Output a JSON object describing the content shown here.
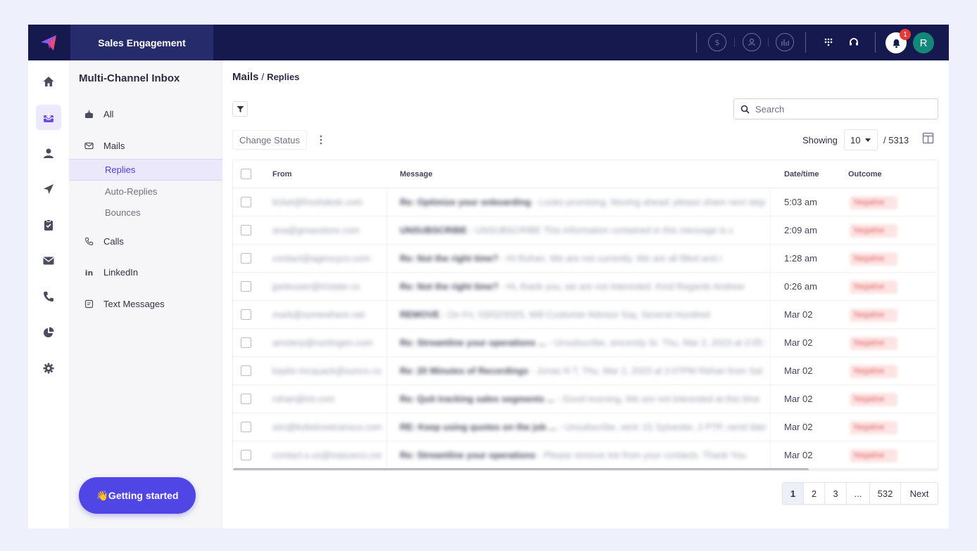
{
  "topbar": {
    "product": "Sales Engagement",
    "notification_count": "1",
    "avatar_initial": "R"
  },
  "sidebar": {
    "title": "Multi-Channel Inbox",
    "items": [
      {
        "label": "All",
        "icon": "inbox-all-icon"
      },
      {
        "label": "Mails",
        "icon": "mail-icon"
      },
      {
        "label": "Calls",
        "icon": "phone-icon"
      },
      {
        "label": "LinkedIn",
        "icon": "linkedin-icon"
      },
      {
        "label": "Text Messages",
        "icon": "text-message-icon"
      }
    ],
    "mail_subitems": [
      "Replies",
      "Auto-Replies",
      "Bounces"
    ],
    "active_subitem": "Replies",
    "getting_started": "👋Getting started"
  },
  "main": {
    "breadcrumb_parent": "Mails",
    "breadcrumb_sep": " / ",
    "breadcrumb_current": "Replies",
    "search_placeholder": "Search",
    "change_status": "Change Status",
    "showing_label": "Showing",
    "page_size": "10",
    "total": "/ 5313",
    "columns": {
      "from": "From",
      "message": "Message",
      "datetime": "Date/time",
      "outcome": "Outcome"
    },
    "rows": [
      {
        "from": "ticket@freshdesk.com",
        "subject": "Re: Optimize your onboarding",
        "preview": "- Looks promising. Moving ahead; please share next steps",
        "datetime": "5:03 am",
        "outcome": "Negative"
      },
      {
        "from": "ana@gmaxstore.com",
        "subject": "UNSUBSCRIBE",
        "preview": "- UNSUBSCRIBE This information contained in this message is c",
        "datetime": "2:09 am",
        "outcome": "Negative"
      },
      {
        "from": "contact@agencyco.com",
        "subject": "Re: Not the right time?",
        "preview": "- Hi Rohan, We are not currently. We are all filled and r",
        "datetime": "1:28 am",
        "outcome": "Negative"
      },
      {
        "from": "jpelessier@tristate.co",
        "subject": "Re: Not the right time?",
        "preview": "- Hi, thank you, we are not interested. Kind Regards Andrew",
        "datetime": "0:26 am",
        "outcome": "Negative"
      },
      {
        "from": "mark@somewhere.net",
        "subject": "REMOVE",
        "preview": "- On Fri, 03/02/2025, Will Customer Advisor Say, Several Hundred",
        "datetime": "Mar 02",
        "outcome": "Negative"
      },
      {
        "from": "amsterp@nortingen.com",
        "subject": "Re: Streamline your operations ...",
        "preview": "- Unsubscribe, sincerely Sr. Thu, Mar 2, 2023 at 2:05 P",
        "datetime": "Mar 02",
        "outcome": "Negative"
      },
      {
        "from": "kaylor.mcquack@sunco.com",
        "subject": "Re: 20 Minutes of Recordings",
        "preview": "- Jonas N T, Thu, Mar 2, 2023 at 2:07PM Rehan from Sal",
        "datetime": "Mar 02",
        "outcome": "Negative"
      },
      {
        "from": "rohan@int.com",
        "subject": "Re: Quit tracking sales segments ...",
        "preview": "- Good morning, We are not interested at this time",
        "datetime": "Mar 02",
        "outcome": "Negative"
      },
      {
        "from": "sim@kobelovetransco.com",
        "subject": "RE: Keep using quotes on the job ...",
        "preview": "- Unsubscribe, sent: 01 Sylvester, 2 PTP, send data",
        "datetime": "Mar 02",
        "outcome": "Negative"
      },
      {
        "from": "contact.s.us@maxxeco.com",
        "subject": "Re: Streamline your operations",
        "preview": "- Please remove me from your contacts. Thank You",
        "datetime": "Mar 02",
        "outcome": "Negative"
      }
    ],
    "pagination": [
      "1",
      "2",
      "3",
      "...",
      "532",
      "Next"
    ],
    "current_page": "1"
  },
  "colors": {
    "topbar_bg": "#15194d",
    "accent": "#4f46e5",
    "avatar": "#13877a",
    "badge": "#e53935"
  }
}
